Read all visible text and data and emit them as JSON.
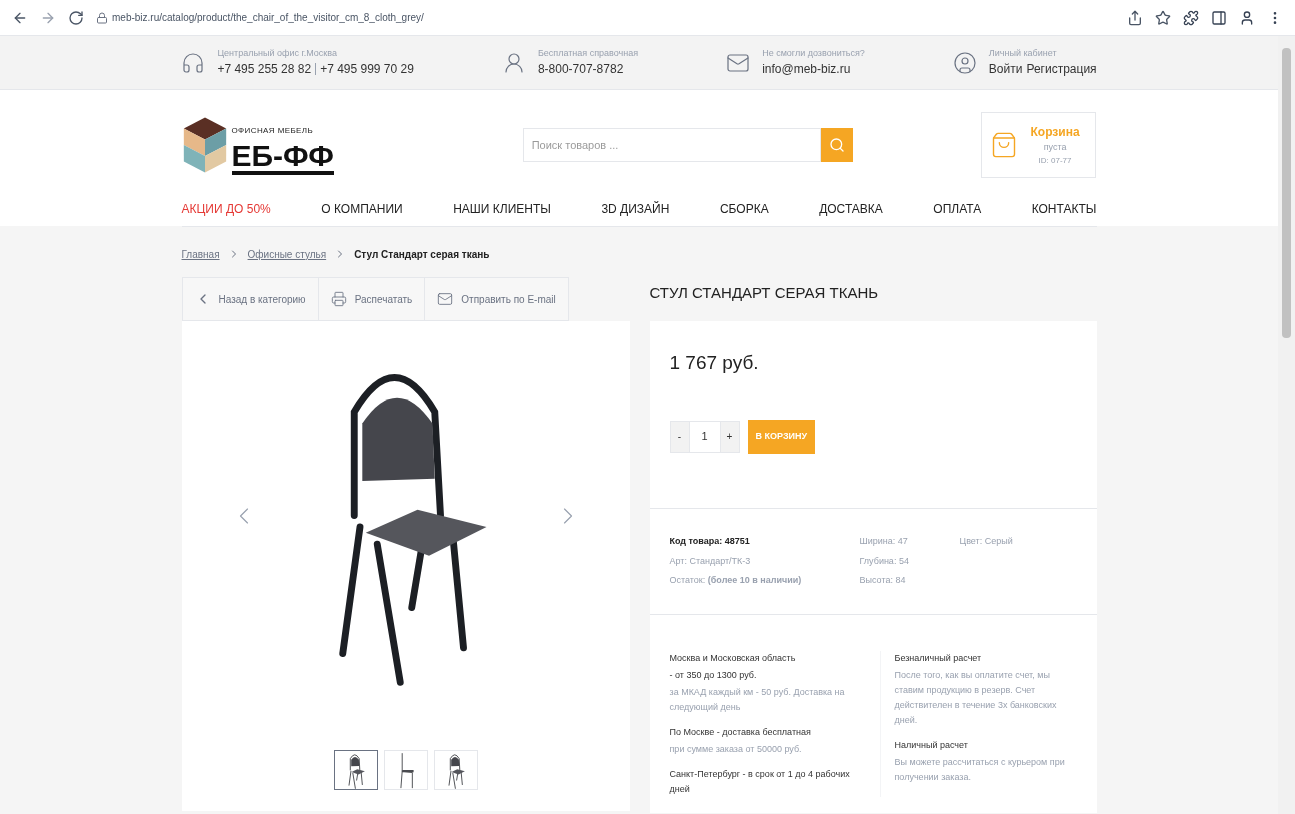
{
  "browser": {
    "url": "meb-biz.ru/catalog/product/the_chair_of_the_visitor_cm_8_cloth_grey/"
  },
  "topbar": [
    {
      "kind": "phone",
      "label": "Центральный офис г.Москва",
      "values": [
        "+7 495 255 28 82",
        "+7 495 999 70 29"
      ]
    },
    {
      "kind": "hotline",
      "label": "Бесплатная справочная",
      "values": [
        "8-800-707-8782"
      ]
    },
    {
      "kind": "mail",
      "label": "Не смогли дозвониться?",
      "values": [
        "info@meb-biz.ru"
      ]
    },
    {
      "kind": "account",
      "label": "Личный кабинет",
      "values": [
        "Войти",
        "Регистрация"
      ]
    }
  ],
  "logo": {
    "tagline": "ОФИСНАЯ МЕБЕЛЬ",
    "text": "ЕБ-ФФ"
  },
  "search": {
    "placeholder": "Поиск товаров ..."
  },
  "cart": {
    "title": "Корзина",
    "status": "пуста",
    "id": "ID: 07-77"
  },
  "nav": [
    {
      "label": "АКЦИИ ДО 50%",
      "highlight": true
    },
    {
      "label": "О КОМПАНИИ",
      "highlight": false
    },
    {
      "label": "НАШИ КЛИЕНТЫ",
      "highlight": false
    },
    {
      "label": "3D ДИЗАЙН",
      "highlight": false
    },
    {
      "label": "СБОРКА",
      "highlight": false
    },
    {
      "label": "ДОСТАВКА",
      "highlight": false
    },
    {
      "label": "ОПЛАТА",
      "highlight": false
    },
    {
      "label": "КОНТАКТЫ",
      "highlight": false
    }
  ],
  "breadcrumb": [
    {
      "label": "Главная",
      "link": true
    },
    {
      "label": "Офисные стулья",
      "link": true
    },
    {
      "label": "Стул Стандарт серая ткань",
      "link": false
    }
  ],
  "actions": [
    {
      "kind": "back",
      "label": "Назад в категорию"
    },
    {
      "kind": "print",
      "label": "Распечатать"
    },
    {
      "kind": "email",
      "label": "Отправить по E-mail"
    }
  ],
  "gallery": {
    "thumbnails": [
      {
        "kind": "front",
        "selected": true
      },
      {
        "kind": "side",
        "selected": false
      },
      {
        "kind": "back",
        "selected": false
      }
    ]
  },
  "product": {
    "title": "СТУЛ СТАНДАРТ СЕРАЯ ТКАНЬ",
    "price": "1 767 руб.",
    "quantity": "1",
    "minus": "-",
    "plus": "+",
    "add_button": "В КОРЗИНУ"
  },
  "specs": [
    [
      {
        "text": "Код товара: 48751",
        "bold": true
      },
      {
        "text": "Арт: Стандарт/ТК-3",
        "bold": false
      },
      {
        "text": "Остаток: **(более 10 в наличии)**",
        "bold": false
      }
    ],
    [
      {
        "text": "Ширина: 47",
        "bold": false
      },
      {
        "text": "Глубина: 54",
        "bold": false
      },
      {
        "text": "Высота: 84",
        "bold": false
      }
    ],
    [
      {
        "text": "Цвет: Серый",
        "bold": false
      }
    ]
  ],
  "info": [
    [
      {
        "lines": [
          {
            "text": "Москва и Московская область",
            "muted": false
          },
          {
            "text": "- от 350 до 1300 руб.",
            "muted": false
          },
          {
            "text": "за МКАД каждый км - 50 руб. Доставка на следующий день",
            "muted": true
          }
        ]
      },
      {
        "lines": [
          {
            "text": "По Москве - доставка бесплатная",
            "muted": false
          },
          {
            "text": "при сумме заказа от 50000 руб.",
            "muted": true
          }
        ]
      },
      {
        "lines": [
          {
            "text": "Санкт-Петербург - в срок от 1 до 4 рабочих дней",
            "muted": false
          }
        ]
      }
    ],
    [
      {
        "lines": [
          {
            "text": "Безналичный расчет",
            "muted": false
          },
          {
            "text": "После того, как вы оплатите счет, мы ставим продукцию в резерв. Счет действителен в течение 3х банковских дней.",
            "muted": true
          }
        ]
      },
      {
        "lines": [
          {
            "text": "Наличный расчет",
            "muted": false
          },
          {
            "text": "Вы можете рассчитаться с курьером при получении заказа.",
            "muted": true
          }
        ]
      }
    ]
  ]
}
